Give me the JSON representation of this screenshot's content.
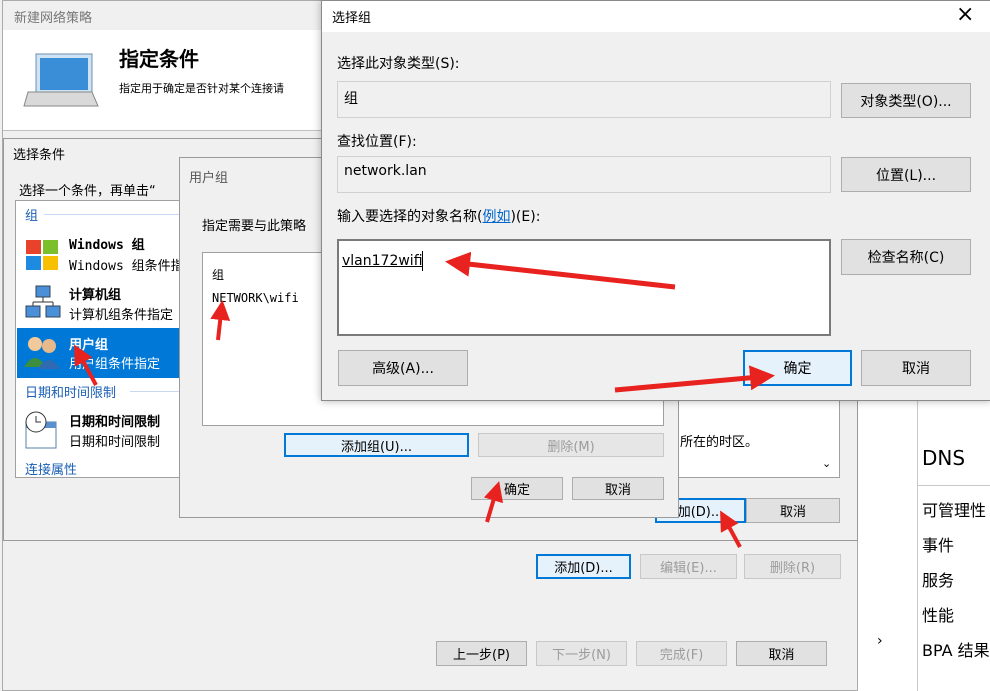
{
  "wizard": {
    "title": "新建网络策略",
    "header_title": "指定条件",
    "header_desc": "指定用于确定是否针对某个连接请",
    "add_label": "添加(D)...",
    "edit_label": "编辑(E)...",
    "remove_label": "删除(R)",
    "prev_label": "上一步(P)",
    "next_label": "下一步(N)",
    "finish_label": "完成(F)",
    "cancel_label": "取消"
  },
  "select_condition": {
    "title": "选择条件",
    "instruction": "选择一个条件，再单击“",
    "group_header": "组",
    "items": [
      {
        "title": "Windows 组",
        "desc": "Windows 组条件指"
      },
      {
        "title": "计算机组",
        "desc": "计算机组条件指定"
      },
      {
        "title": "用户组",
        "desc": "用户组条件指定"
      },
      {
        "title": "日期和时间限制",
        "desc": "日期和时间限制"
      }
    ],
    "date_header": "日期和时间限制",
    "conn_header": "连接属性",
    "timezone_text": "所在的时区。",
    "add_label": "加(D)...",
    "cancel_label": "取消"
  },
  "user_group": {
    "title": "用户组",
    "instruction": "指定需要与此策略",
    "list_header": "组",
    "entry": "NETWORK\\wifi",
    "add_group_label": "添加组(U)...",
    "remove_label": "删除(M)",
    "ok_label": "确定",
    "cancel_label": "取消"
  },
  "select_group": {
    "title": "选择组",
    "object_type_label": "选择此对象类型(S):",
    "object_type_value": "组",
    "object_type_button": "对象类型(O)...",
    "location_label": "查找位置(F):",
    "location_value": "network.lan",
    "location_button": "位置(L)...",
    "name_label_pre": "输入要选择的对象名称(",
    "name_label_link": "例如",
    "name_label_post": ")(E):",
    "name_value": "vlan172wifi",
    "check_button": "检查名称(C)",
    "advanced_button": "高级(A)...",
    "ok_button": "确定",
    "cancel_button": "取消"
  },
  "server_manager": {
    "section_title": "DNS",
    "items": [
      "可管理性",
      "事件",
      "服务",
      "性能",
      "BPA 结果"
    ]
  },
  "colors": {
    "accent": "#0078d7",
    "selected": "#0078d7",
    "arrow": "#e8221f",
    "link": "#0066cc"
  }
}
